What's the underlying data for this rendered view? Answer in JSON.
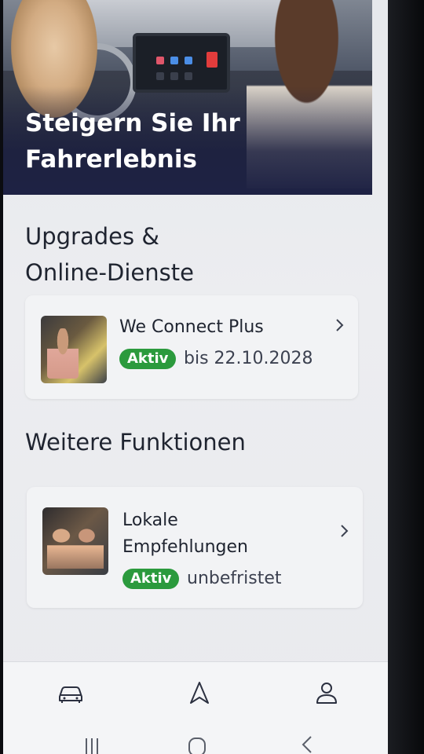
{
  "hero": {
    "title_line1": "Steigern Sie Ihr",
    "title_line2": "Fahrerlebnis"
  },
  "upgrades": {
    "title_line1": "Upgrades &",
    "title_line2": "Online-Dienste",
    "items": [
      {
        "name": "We Connect Plus",
        "badge": "Aktiv",
        "validity": "bis 22.10.2028",
        "icon": "chevron-right-icon"
      }
    ]
  },
  "more": {
    "title": "Weitere Funktionen",
    "items": [
      {
        "name_line1": "Lokale",
        "name_line2": "Empfehlungen",
        "badge": "Aktiv",
        "validity": "unbefristet",
        "icon": "chevron-right-icon"
      }
    ]
  },
  "bottom_nav": {
    "items": [
      {
        "icon": "car-icon"
      },
      {
        "icon": "navigation-icon"
      },
      {
        "icon": "profile-icon"
      }
    ]
  },
  "system_nav": {
    "items": [
      {
        "icon": "recent-apps-icon"
      },
      {
        "icon": "home-icon"
      },
      {
        "icon": "back-icon"
      }
    ]
  },
  "colors": {
    "badge": "#2b9a3d",
    "hero_bg": "#1e2244",
    "text": "#1f2430"
  }
}
